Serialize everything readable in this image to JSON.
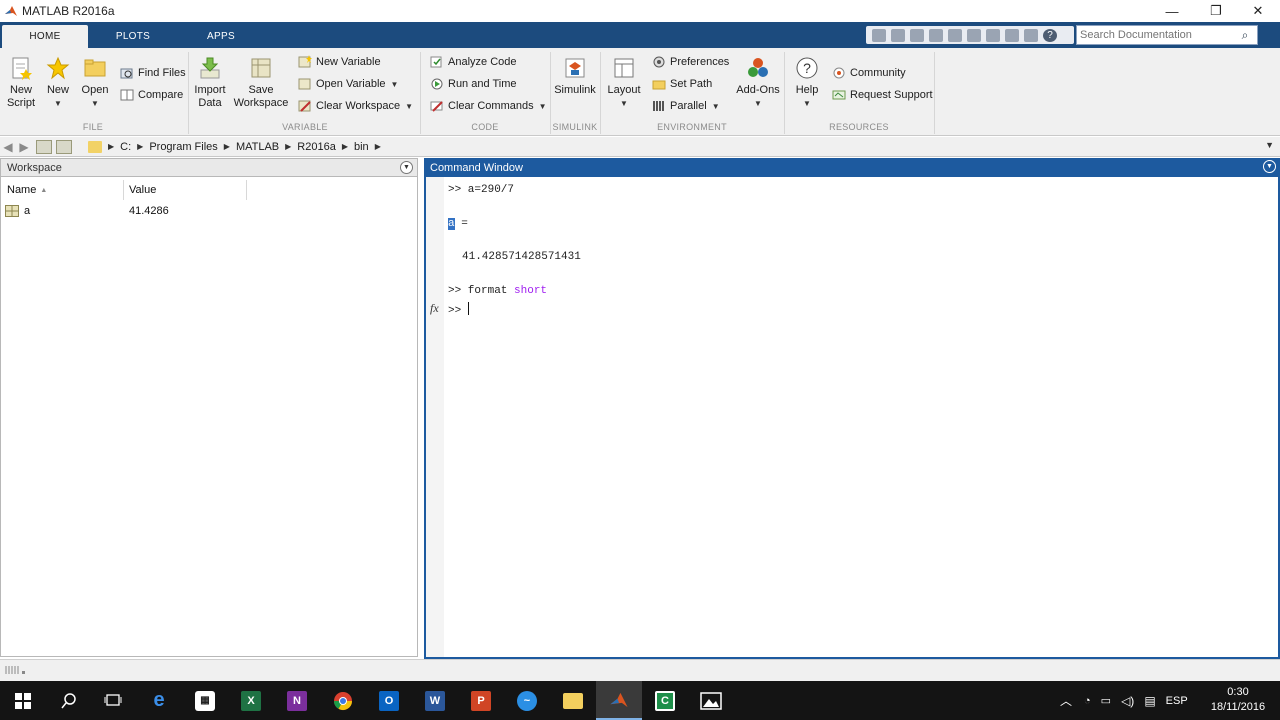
{
  "window": {
    "title": "MATLAB R2016a",
    "controls": {
      "minimize": "—",
      "restore": "❐",
      "close": "✕"
    }
  },
  "tabs": [
    {
      "label": "HOME",
      "active": true
    },
    {
      "label": "PLOTS",
      "active": false
    },
    {
      "label": "APPS",
      "active": false
    }
  ],
  "search": {
    "placeholder": "Search Documentation"
  },
  "ribbon": {
    "file": {
      "group_label": "FILE",
      "new_script": [
        "New",
        "Script"
      ],
      "new": "New",
      "open": "Open",
      "find_files": "Find Files",
      "compare": "Compare"
    },
    "variable": {
      "group_label": "VARIABLE",
      "import_data": [
        "Import",
        "Data"
      ],
      "save_workspace": [
        "Save",
        "Workspace"
      ],
      "new_variable": "New Variable",
      "open_variable": "Open Variable",
      "clear_workspace": "Clear Workspace"
    },
    "code": {
      "group_label": "CODE",
      "analyze_code": "Analyze Code",
      "run_and_time": "Run and Time",
      "clear_commands": "Clear Commands"
    },
    "simulink": {
      "group_label": "SIMULINK",
      "simulink": "Simulink"
    },
    "environment": {
      "group_label": "ENVIRONMENT",
      "layout": "Layout",
      "preferences": "Preferences",
      "set_path": "Set Path",
      "parallel": "Parallel",
      "addons": "Add-Ons"
    },
    "resources": {
      "group_label": "RESOURCES",
      "help": "Help",
      "community": "Community",
      "request_support": "Request Support"
    }
  },
  "address": {
    "path": [
      "C:",
      "Program Files",
      "MATLAB",
      "R2016a",
      "bin"
    ]
  },
  "workspace": {
    "title": "Workspace",
    "columns": [
      "Name",
      "Value"
    ],
    "sort_indicator": "▲",
    "rows": [
      {
        "name": "a",
        "value": "41.4286"
      }
    ]
  },
  "command_window": {
    "title": "Command Window",
    "lines": {
      "cmd1": ">> a=290/7",
      "ans_var": "a",
      "ans_eq": " =",
      "result": "41.428571428571431",
      "cmd2_prefix": ">> format ",
      "cmd2_kw": "short",
      "prompt": ">> "
    },
    "fx_label": "fx"
  },
  "taskbar": {
    "apps": [
      "start",
      "search",
      "task-view",
      "edge",
      "store",
      "excel",
      "onenote",
      "chrome",
      "outlook",
      "word",
      "powerpoint",
      "messenger",
      "file-explorer",
      "matlab",
      "camtasia",
      "photos"
    ],
    "tray": {
      "language": "ESP",
      "time": "0:30",
      "date": "18/11/2016"
    }
  },
  "colors": {
    "titlebar_tab": "#1c4b7e",
    "command_header": "#1d5a9f",
    "selection": "#3372c4",
    "keyword": "#a020f0",
    "taskbar": "#141414"
  }
}
